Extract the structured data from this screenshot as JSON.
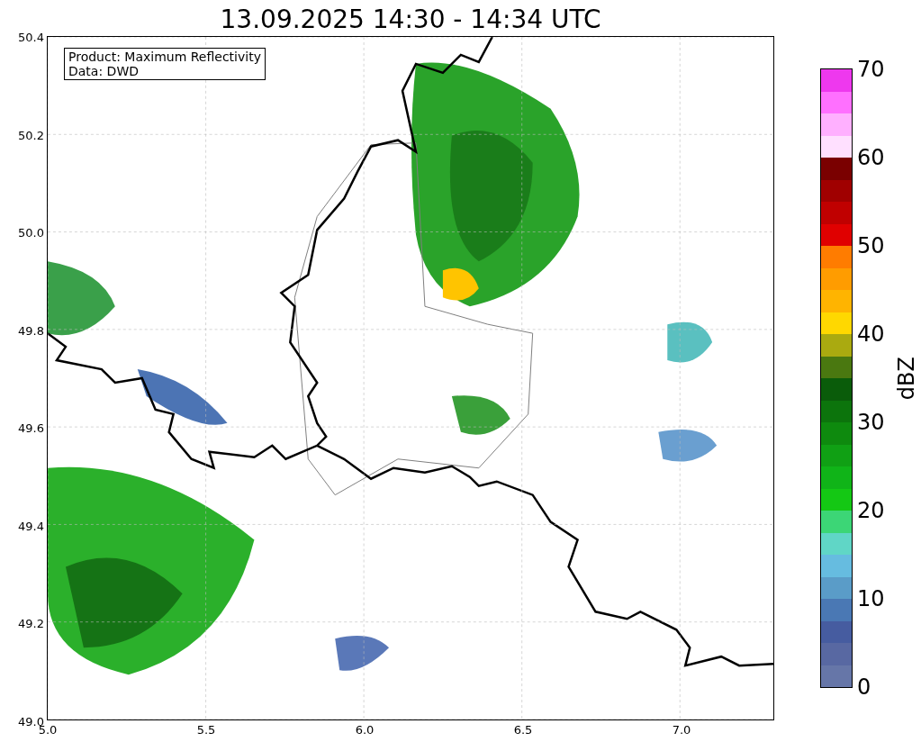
{
  "title": "13.09.2025 14:30 - 14:34 UTC",
  "map": {
    "legend": [
      "Product: Maximum Reflectivity",
      "Data: DWD"
    ],
    "x_ticks": [
      "5.0",
      "5.5",
      "6.0",
      "6.5",
      "7.0"
    ],
    "y_ticks": [
      "50.4",
      "50.2",
      "50.0",
      "49.8",
      "49.6",
      "49.4",
      "49.2",
      "49.0"
    ]
  },
  "colorbar": {
    "label": "dBZ",
    "ticks": [
      "70",
      "60",
      "50",
      "40",
      "30",
      "20",
      "10",
      "0"
    ],
    "bands": [
      {
        "color": "#6676a8"
      },
      {
        "color": "#5868a2"
      },
      {
        "color": "#465ca0"
      },
      {
        "color": "#4a78b4"
      },
      {
        "color": "#5a9cc8"
      },
      {
        "color": "#66bce0"
      },
      {
        "color": "#60d6c6"
      },
      {
        "color": "#3cd676"
      },
      {
        "color": "#14c814"
      },
      {
        "color": "#10b418"
      },
      {
        "color": "#10a014"
      },
      {
        "color": "#0e8a0e"
      },
      {
        "color": "#0c740c"
      },
      {
        "color": "#0a5c0a"
      },
      {
        "color": "#4a7810"
      },
      {
        "color": "#aaaa10"
      },
      {
        "color": "#ffd800"
      },
      {
        "color": "#ffb400"
      },
      {
        "color": "#ff9c00"
      },
      {
        "color": "#ff7c00"
      },
      {
        "color": "#e00000"
      },
      {
        "color": "#c00000"
      },
      {
        "color": "#a00000"
      },
      {
        "color": "#7a0000"
      },
      {
        "color": "#ffe0ff"
      },
      {
        "color": "#ffb0ff"
      },
      {
        "color": "#ff70ff"
      },
      {
        "color": "#ee38ee"
      }
    ]
  }
}
